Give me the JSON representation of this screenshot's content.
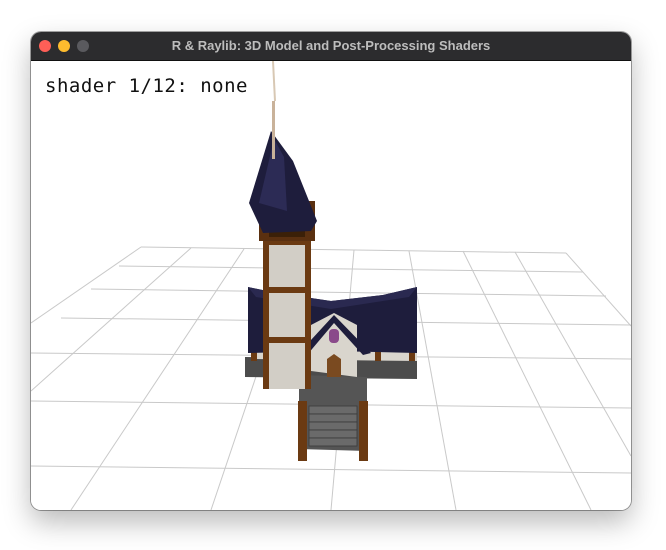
{
  "window": {
    "title": "R & Raylib: 3D Model and Post-Processing Shaders"
  },
  "hud": {
    "shader_text": "shader 1/12: none"
  },
  "colors": {
    "titlebar": "#2c2c2e",
    "close": "#ff5f57",
    "minimize": "#febc2e",
    "maximize_disabled": "#5a5a5e",
    "grid": "#c8c8c8",
    "roof": "#1e1d3c",
    "wood": "#6b3a12",
    "plaster": "#dcd8d0",
    "stone": "#4a4a4a"
  },
  "scene": {
    "model": "church",
    "icons": [
      "close-icon",
      "minimize-icon",
      "maximize-icon"
    ]
  }
}
